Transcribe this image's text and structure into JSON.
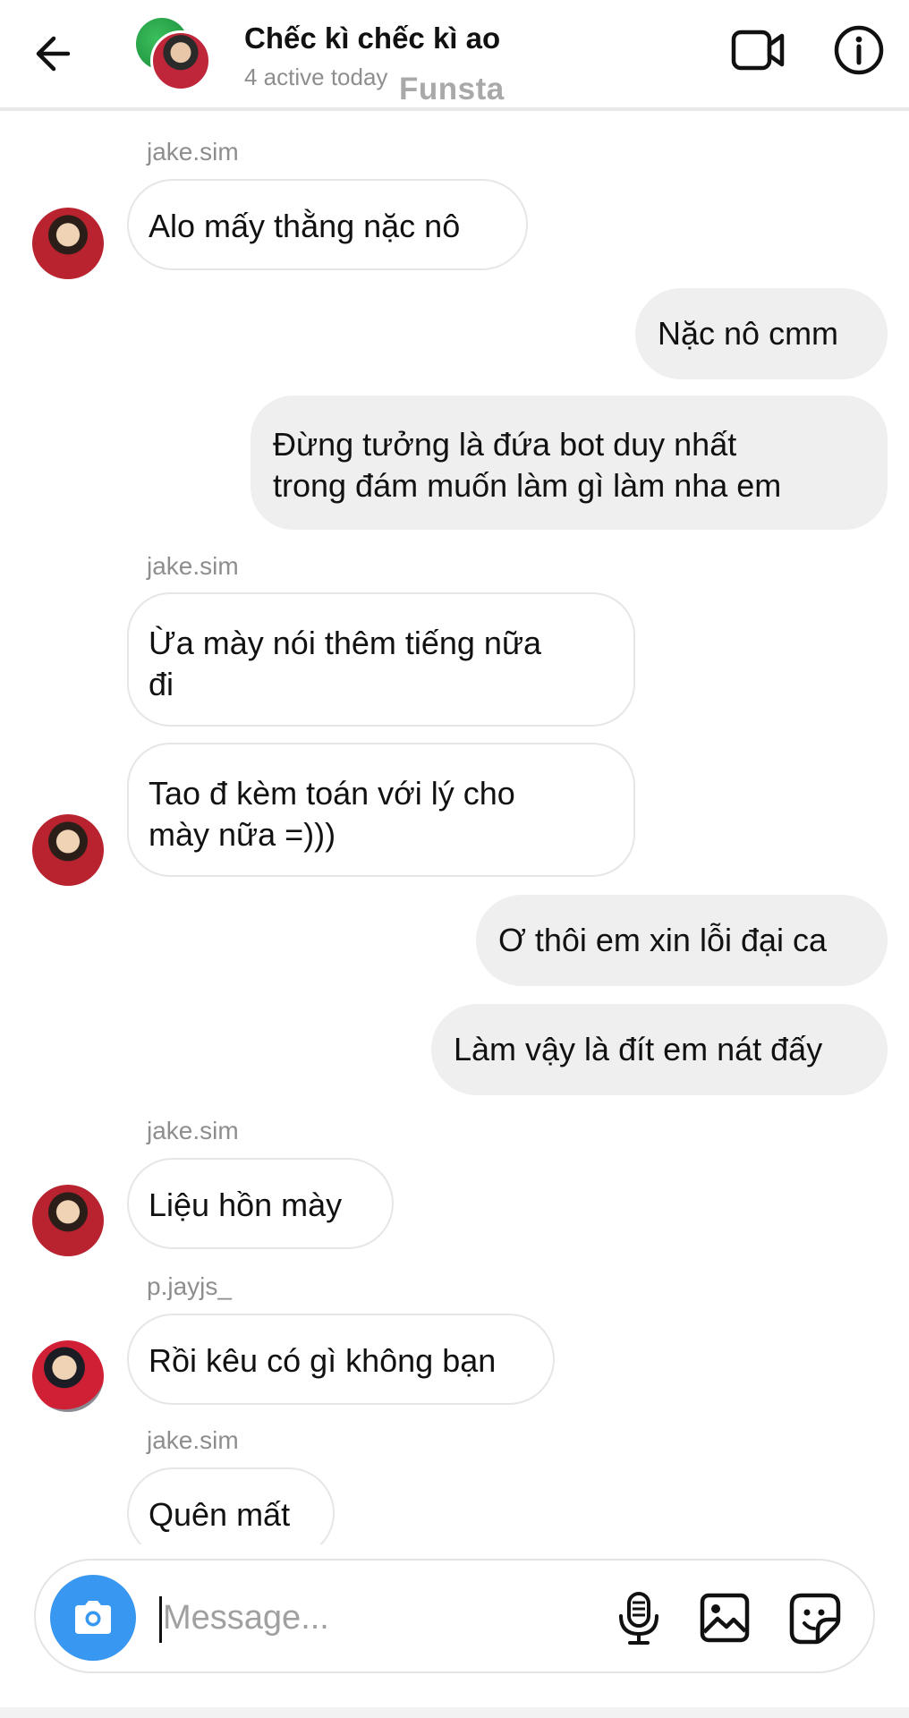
{
  "header": {
    "title": "Chếc kì chếc kì ao",
    "subtitle": "4 active today",
    "watermark": "Funsta",
    "back_icon": "arrow-left-icon",
    "video_icon": "video-camera-icon",
    "info_icon": "info-icon"
  },
  "messages": [
    {
      "id": "m1",
      "direction": "incoming",
      "sender": "jake.sim",
      "text": "Alo mấy thằng nặc nô"
    },
    {
      "id": "m2",
      "direction": "outgoing",
      "text": "Nặc nô cmm"
    },
    {
      "id": "m3",
      "direction": "outgoing",
      "lines": [
        "Đừng tưởng là đứa bot duy nhất",
        "trong đám muốn làm gì làm nha em"
      ]
    },
    {
      "id": "m4",
      "direction": "incoming",
      "sender": "jake.sim",
      "lines": [
        "Ừa mày nói thêm tiếng nữa",
        "đi"
      ]
    },
    {
      "id": "m5",
      "direction": "incoming",
      "lines": [
        "Tao đ kèm toán với lý cho",
        "mày nữa =)))"
      ]
    },
    {
      "id": "m6",
      "direction": "outgoing",
      "text": "Ơ thôi em xin lỗi đại ca"
    },
    {
      "id": "m7",
      "direction": "outgoing",
      "text": "Làm vậy là đít em nát đấy"
    },
    {
      "id": "m8",
      "direction": "incoming",
      "sender": "jake.sim",
      "text": "Liệu hồn mày"
    },
    {
      "id": "m9",
      "direction": "incoming",
      "sender": "p.jayjs_",
      "text": "Rồi kêu có gì không bạn"
    },
    {
      "id": "m10",
      "direction": "incoming",
      "sender": "jake.sim",
      "text": "Quên mất"
    }
  ],
  "composer": {
    "placeholder": "Message...",
    "value": "",
    "camera_icon": "camera-icon",
    "mic_icon": "microphone-icon",
    "gallery_icon": "image-gallery-icon",
    "sticker_icon": "sticker-icon",
    "accent_color": "#3897f0"
  },
  "colors": {
    "outgoing_bubble": "#efefef",
    "incoming_bubble_border": "#e6e6e6",
    "secondary_text": "#8e8e8e"
  }
}
